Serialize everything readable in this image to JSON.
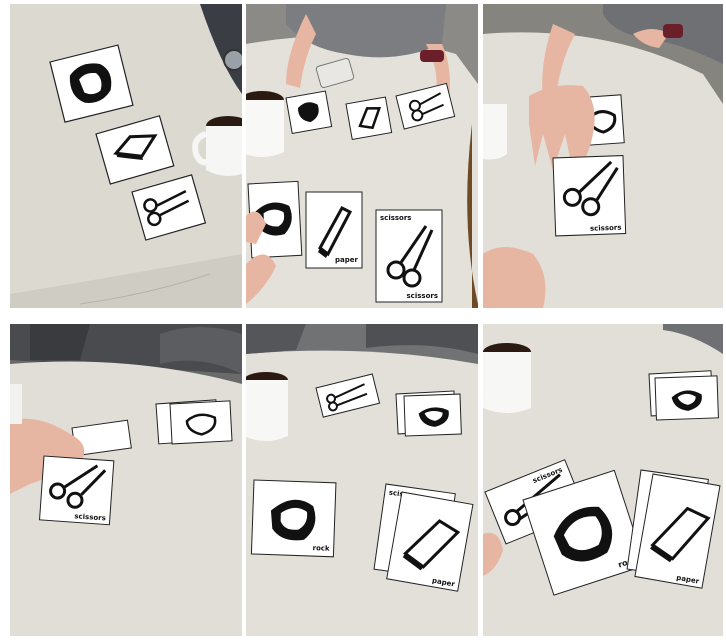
{
  "photos": [
    {
      "id": "p1",
      "cards": [
        {
          "label": ""
        },
        {
          "label": ""
        },
        {
          "label": ""
        }
      ]
    },
    {
      "id": "p2",
      "cards": [
        {
          "label": "scissors"
        },
        {
          "label": "paper"
        },
        {
          "label": "scissors"
        }
      ]
    },
    {
      "id": "p3",
      "cards": [
        {
          "label": "scissors"
        }
      ]
    },
    {
      "id": "p4",
      "cards": [
        {
          "label": "scissors"
        }
      ]
    },
    {
      "id": "p5",
      "cards": [
        {
          "label": "rock"
        },
        {
          "label": "scissors"
        },
        {
          "label": "paper"
        }
      ]
    },
    {
      "id": "p6",
      "cards": [
        {
          "label": "scissors"
        },
        {
          "label": "rock"
        },
        {
          "label": "paper"
        }
      ]
    }
  ],
  "colors": {
    "table": "#e6e3dc",
    "table_shadow": "#bdb9b1",
    "card": "#ffffff",
    "ink": "#111111",
    "background": "#ffffff"
  }
}
